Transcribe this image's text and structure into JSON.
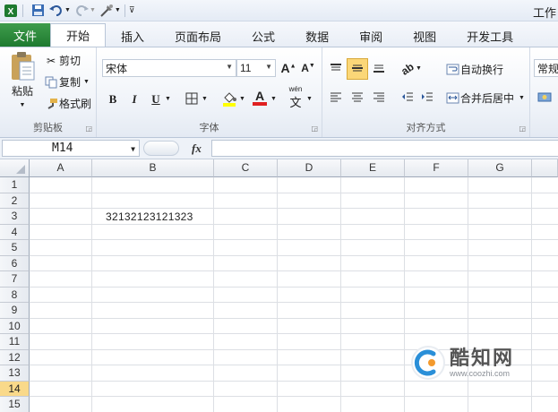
{
  "window": {
    "title": "工作"
  },
  "colors": {
    "file_tab": "#1e7a2f",
    "active_row": "#f9d98a",
    "accent": "#2b579a"
  },
  "tabs": [
    {
      "label": "文件"
    },
    {
      "label": "开始"
    },
    {
      "label": "插入"
    },
    {
      "label": "页面布局"
    },
    {
      "label": "公式"
    },
    {
      "label": "数据"
    },
    {
      "label": "审阅"
    },
    {
      "label": "视图"
    },
    {
      "label": "开发工具"
    }
  ],
  "clipboard": {
    "paste": "粘贴",
    "cut": "剪切",
    "copy": "复制",
    "format_painter": "格式刷",
    "label": "剪贴板"
  },
  "font": {
    "name": "宋体",
    "size": "11",
    "bold": "B",
    "italic": "I",
    "underline": "U",
    "label": "字体",
    "phonetic": "wén"
  },
  "alignment": {
    "wrap_text": "自动换行",
    "merge_center": "合并后居中",
    "label": "对齐方式"
  },
  "number": {
    "format": "常规"
  },
  "formula_bar": {
    "name_box": "M14",
    "fx": "fx",
    "value": ""
  },
  "sheet": {
    "columns": [
      "A",
      "B",
      "C",
      "D",
      "E",
      "F",
      "G"
    ],
    "rows": [
      "1",
      "2",
      "3",
      "4",
      "5",
      "6",
      "7",
      "8",
      "9",
      "10",
      "11",
      "12",
      "13",
      "14",
      "15"
    ],
    "active_row": "14",
    "cells": {
      "B3": "32132123121323"
    }
  },
  "watermark": {
    "title": "酷知网",
    "url": "www.coozhi.com"
  }
}
